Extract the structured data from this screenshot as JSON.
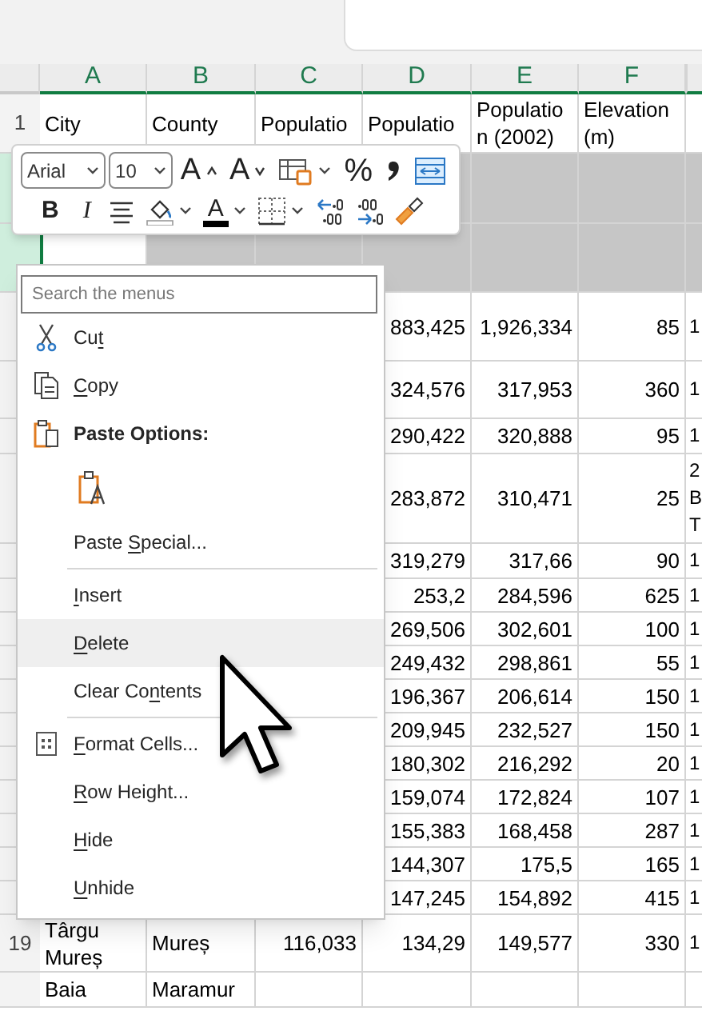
{
  "columns": [
    "A",
    "B",
    "C",
    "D",
    "E",
    "F"
  ],
  "rows": [
    {
      "number": "1",
      "selected": false,
      "cells": {
        "a": "City",
        "b": "County",
        "c": "Populatio",
        "d": "Populatio",
        "e": "Populatio n (2002)",
        "f": "Elevation (m)"
      }
    },
    {
      "selected": true,
      "cells": {}
    },
    {
      "selected": true,
      "cells": {}
    },
    {
      "selected": false,
      "cells": {
        "d": "883,425",
        "e": "1,926,334",
        "f": "85",
        "g": "1"
      }
    },
    {
      "selected": false,
      "cells": {
        "d": "324,576",
        "e": "317,953",
        "f": "360",
        "g": "1"
      }
    },
    {
      "selected": false,
      "cells": {
        "d": "290,422",
        "e": "320,888",
        "f": "95",
        "g": "1"
      }
    },
    {
      "selected": false,
      "cells": {
        "d": "283,872",
        "e": "310,471",
        "f": "25",
        "g": "2\nB\nT"
      }
    },
    {
      "selected": false,
      "cells": {
        "d": "319,279",
        "e": "317,66",
        "f": "90",
        "g": "1"
      }
    },
    {
      "selected": false,
      "cells": {
        "d": "253,2",
        "e": "284,596",
        "f": "625",
        "g": "1"
      }
    },
    {
      "selected": false,
      "cells": {
        "d": "269,506",
        "e": "302,601",
        "f": "100",
        "g": "1"
      }
    },
    {
      "selected": false,
      "cells": {
        "d": "249,432",
        "e": "298,861",
        "f": "55",
        "g": "1"
      }
    },
    {
      "selected": false,
      "cells": {
        "d": "196,367",
        "e": "206,614",
        "f": "150",
        "g": "1"
      }
    },
    {
      "selected": false,
      "cells": {
        "d": "209,945",
        "e": "232,527",
        "f": "150",
        "g": "1"
      }
    },
    {
      "selected": false,
      "cells": {
        "d": "180,302",
        "e": "216,292",
        "f": "20",
        "g": "1"
      }
    },
    {
      "selected": false,
      "cells": {
        "d": "159,074",
        "e": "172,824",
        "f": "107",
        "g": "1"
      }
    },
    {
      "selected": false,
      "cells": {
        "d": "155,383",
        "e": "168,458",
        "f": "287",
        "g": "1"
      }
    },
    {
      "selected": false,
      "cells": {
        "d": "144,307",
        "e": "175,5",
        "f": "165",
        "g": "1"
      }
    },
    {
      "selected": false,
      "cells": {
        "d": "147,245",
        "e": "154,892",
        "f": "415",
        "g": "1"
      }
    },
    {
      "number": "19",
      "selected": false,
      "cells": {
        "a": "Târgu Mureș",
        "b": "Mureș",
        "c": "116,033",
        "d": "134,29",
        "e": "149,577",
        "f": "330",
        "g": "1"
      }
    },
    {
      "selected": false,
      "cells": {
        "a": "Baia",
        "b": "Maramur"
      }
    }
  ],
  "toolbar": {
    "font": "Arial",
    "size": "10",
    "row_1": [
      {
        "kind": "grow",
        "glyph": "A"
      },
      {
        "kind": "shrink",
        "glyph": "A"
      },
      {
        "kind": "styles"
      },
      {
        "kind": "percent",
        "glyph": "%"
      },
      {
        "kind": "comma"
      },
      {
        "kind": "wrap"
      }
    ],
    "row_2": [
      {
        "kind": "bold",
        "glyph": "B"
      },
      {
        "kind": "italic",
        "glyph": "I"
      },
      {
        "kind": "align"
      },
      {
        "kind": "fill"
      },
      {
        "kind": "fontcolor",
        "glyph": "A"
      },
      {
        "kind": "borders"
      },
      {
        "kind": "incdec"
      },
      {
        "kind": "decdec"
      },
      {
        "kind": "painter"
      }
    ]
  },
  "context_menu": {
    "search": {
      "placeholder": "Search the menus"
    },
    "items": [
      {
        "kind": "cut",
        "label_parts": [
          {
            "text": "Cu",
            "underlined": false
          },
          {
            "text": "t",
            "underlined": true
          }
        ],
        "highlighted": false
      },
      {
        "kind": "copy",
        "label_parts": [
          {
            "text": "C",
            "underlined": true
          },
          {
            "text": "opy",
            "underlined": false
          }
        ],
        "highlighted": false
      },
      {
        "kind": "paste",
        "label": "Paste Options:",
        "highlighted": false
      },
      {
        "kind": "pasteoption",
        "highlighted": false
      },
      {
        "kind": "plain",
        "label_parts": [
          {
            "text": "Paste ",
            "underlined": false
          },
          {
            "text": "S",
            "underlined": true
          },
          {
            "text": "pecial...",
            "underlined": false
          }
        ],
        "highlighted": false
      },
      {
        "kind": "separator"
      },
      {
        "kind": "plain",
        "label_parts": [
          {
            "text": "I",
            "underlined": true
          },
          {
            "text": "nsert",
            "underlined": false
          }
        ],
        "highlighted": false
      },
      {
        "kind": "plain",
        "label_parts": [
          {
            "text": "D",
            "underlined": true
          },
          {
            "text": "elete",
            "underlined": false
          }
        ],
        "highlighted": true
      },
      {
        "kind": "plain",
        "label_parts": [
          {
            "text": "Clear Co",
            "underlined": false
          },
          {
            "text": "n",
            "underlined": true
          },
          {
            "text": "tents",
            "underlined": false
          }
        ],
        "highlighted": false
      },
      {
        "kind": "separator"
      },
      {
        "kind": "format",
        "label_parts": [
          {
            "text": "F",
            "underlined": true
          },
          {
            "text": "ormat Cells...",
            "underlined": false
          }
        ],
        "highlighted": false
      },
      {
        "kind": "plain",
        "label_parts": [
          {
            "text": "R",
            "underlined": true
          },
          {
            "text": "ow Height...",
            "underlined": false
          }
        ],
        "highlighted": false
      },
      {
        "kind": "plain",
        "label_parts": [
          {
            "text": "H",
            "underlined": true
          },
          {
            "text": "ide",
            "underlined": false
          }
        ],
        "highlighted": false
      },
      {
        "kind": "plain",
        "label_parts": [
          {
            "text": "U",
            "underlined": true
          },
          {
            "text": "nhide",
            "underlined": false
          }
        ],
        "highlighted": false
      }
    ]
  }
}
